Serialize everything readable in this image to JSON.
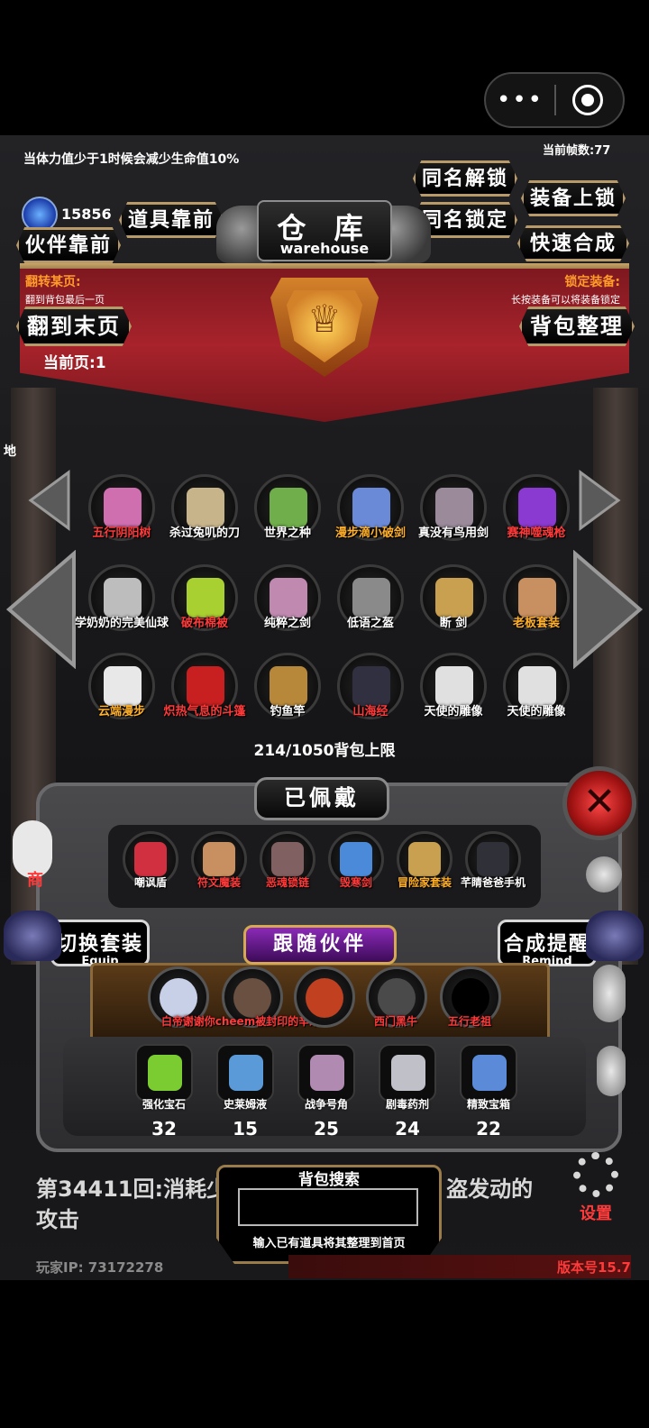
{
  "capsule": {
    "more": "•••",
    "close_icon": "target-icon"
  },
  "header": {
    "warning": "当体力值少于1时候会减少生命值10%",
    "frame_count": "当前帧数:77",
    "gold": "15856"
  },
  "buttons": {
    "same_unlock": "同名解锁",
    "equip_lock": "装备上锁",
    "item_front": "道具靠前",
    "partner_front": "伙伴靠前",
    "same_lock": "同名锁定",
    "quick_merge": "快速合成",
    "last_page": "翻到末页",
    "organize": "背包整理"
  },
  "warehouse": {
    "title_cn": "仓 库",
    "title_en": "warehouse"
  },
  "page_flip": {
    "header": "翻转某页:",
    "sub": "翻到背包最后一页",
    "current": "当前页:1"
  },
  "lock_equip": {
    "header": "锁定装备:",
    "sub": "长按装备可以将装备锁定"
  },
  "side_label": "地",
  "inventory": [
    {
      "name": "五行阴阳树",
      "color": "#ff3a3a",
      "ico": "#d06fb0"
    },
    {
      "name": "杀过兔叽的刀",
      "color": "#ffffff",
      "ico": "#c8b48a"
    },
    {
      "name": "世界之种",
      "color": "#ffffff",
      "ico": "#6fae4a"
    },
    {
      "name": "漫步滴小破剑",
      "color": "#ffb02a",
      "ico": "#6a8ad8"
    },
    {
      "name": "真没有鸟用剑",
      "color": "#ffffff",
      "ico": "#9a8a9a"
    },
    {
      "name": "赛神噬魂枪",
      "color": "#ff3a3a",
      "ico": "#8a3ad0"
    },
    {
      "name": "学奶奶的完美仙球",
      "color": "#ffffff",
      "ico": "#bdbdbd"
    },
    {
      "name": "破布棉被",
      "color": "#ff3a3a",
      "ico": "#a8d030"
    },
    {
      "name": "纯粹之剑",
      "color": "#ffffff",
      "ico": "#c08ab0"
    },
    {
      "name": "低语之盔",
      "color": "#ffffff",
      "ico": "#8a8a8a"
    },
    {
      "name": "断 剑",
      "color": "#ffffff",
      "ico": "#c8a050"
    },
    {
      "name": "老板套装",
      "color": "#ffb02a",
      "ico": "#c89060"
    },
    {
      "name": "云端漫步",
      "color": "#ffb02a",
      "ico": "#e8e8e8"
    },
    {
      "name": "炽热气息的斗篷",
      "color": "#ff3a3a",
      "ico": "#c82020"
    },
    {
      "name": "钓鱼竿",
      "color": "#ffffff",
      "ico": "#b8883a"
    },
    {
      "name": "山海经",
      "color": "#ff3a3a",
      "ico": "#303040"
    },
    {
      "name": "天使的雕像",
      "color": "#ffffff",
      "ico": "#e0e0e0"
    },
    {
      "name": "天使的雕像",
      "color": "#ffffff",
      "ico": "#e0e0e0"
    }
  ],
  "bag": {
    "count": "214/1050背包上限"
  },
  "equipped": {
    "title": "已佩戴",
    "items": [
      {
        "name": "嘲讽盾",
        "color": "#ffffff",
        "ico": "#d03040"
      },
      {
        "name": "符文魔装",
        "color": "#ff3a3a",
        "ico": "#c89060"
      },
      {
        "name": "恶魂锁链",
        "color": "#ff3a3a",
        "ico": "#806060"
      },
      {
        "name": "毁寒剑",
        "color": "#ff3a3a",
        "ico": "#4a8ad8"
      },
      {
        "name": "冒险家套装",
        "color": "#ffb02a",
        "ico": "#c8a050"
      },
      {
        "name": "芊睛爸爸手机",
        "color": "#ffffff",
        "ico": "#303038"
      }
    ]
  },
  "switch_equip": {
    "cn": "切换套装",
    "en": "Equip"
  },
  "merge_remind": {
    "cn": "合成提醒",
    "en": "Remind"
  },
  "follow": {
    "title": "跟随伙伴",
    "partners": [
      {
        "name": "白帝子",
        "ico": "#c8d0e8"
      },
      {
        "name": "谢谢你cheem被封印的辛未",
        "ico": "#6a5040"
      },
      {
        "name": "",
        "ico": "#c04020"
      },
      {
        "name": "西门黑牛",
        "ico": "#4a4a4a"
      },
      {
        "name": "五行老祖",
        "ico": "#000000"
      }
    ]
  },
  "consumables": [
    {
      "name": "强化宝石",
      "count": "32",
      "ico": "#7acc30"
    },
    {
      "name": "史莱姆液",
      "count": "15",
      "ico": "#5a9ad8"
    },
    {
      "name": "战争号角",
      "count": "25",
      "ico": "#b08ab0"
    },
    {
      "name": "剧毒药剂",
      "count": "24",
      "ico": "#c0c0c8"
    },
    {
      "name": "精致宝箱",
      "count": "22",
      "ico": "#5a8ad8"
    }
  ],
  "log": {
    "text_left": "第34411回:消耗少",
    "text_right": "盗发动的",
    "line2": "攻击"
  },
  "search": {
    "title": "背包搜索",
    "hint": "输入已有道具将其整理到首页",
    "value": ""
  },
  "settings": {
    "label": "设置"
  },
  "footer": {
    "ip": "玩家IP:  73172278",
    "version": "版本号15.7"
  },
  "shop_label": "商"
}
